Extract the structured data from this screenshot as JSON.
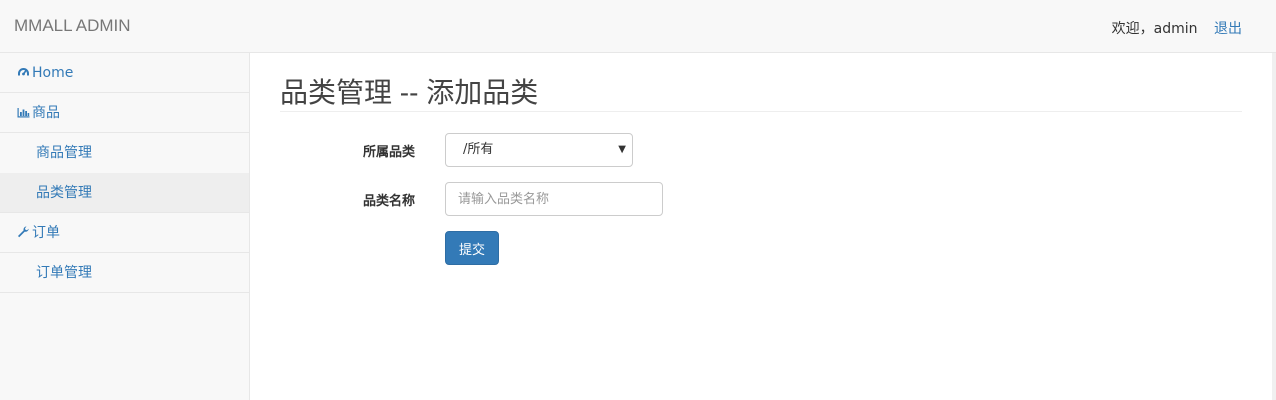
{
  "header": {
    "brand": "MMALL ADMIN",
    "welcome": "欢迎，admin",
    "logout": "退出"
  },
  "sidebar": {
    "items": [
      {
        "label": "Home",
        "icon": "dashboard-icon"
      },
      {
        "label": "商品",
        "icon": "bar-chart-icon"
      },
      {
        "label": "商品管理"
      },
      {
        "label": "品类管理"
      },
      {
        "label": "订单",
        "icon": "wrench-icon"
      },
      {
        "label": "订单管理"
      }
    ]
  },
  "main": {
    "title": "品类管理 -- 添加品类",
    "form": {
      "parent_label": "所属品类",
      "parent_value": "/所有",
      "name_label": "品类名称",
      "name_placeholder": "请输入品类名称",
      "name_value": "",
      "submit_label": "提交"
    }
  },
  "colors": {
    "link": "#337ab7",
    "primary_button": "#337ab7",
    "sidebar_bg": "#f8f8f8",
    "active_item_bg": "#eeeeee"
  }
}
